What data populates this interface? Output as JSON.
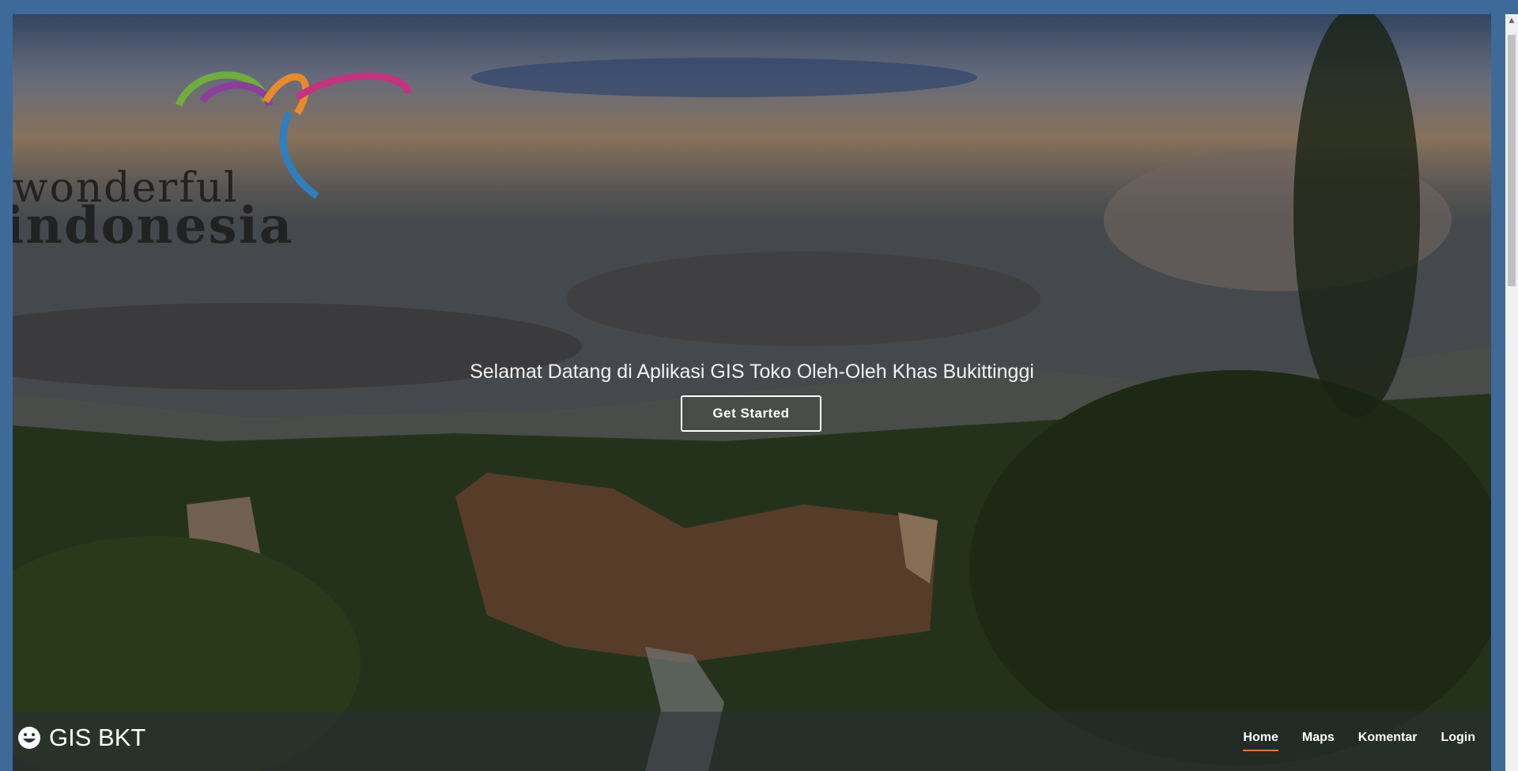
{
  "logo": {
    "line1": "wonderful",
    "line2": "indonesia"
  },
  "hero": {
    "title": "Selamat Datang di Aplikasi GIS Toko Oleh-Oleh Khas Bukittinggi",
    "cta_label": "Get Started"
  },
  "navbar": {
    "brand": "GIS BKT",
    "brand_icon": "grin-icon",
    "links": [
      {
        "label": "Home",
        "active": true
      },
      {
        "label": "Maps",
        "active": false
      },
      {
        "label": "Komentar",
        "active": false
      },
      {
        "label": "Login",
        "active": false
      }
    ],
    "active_underline_color": "#e8743b"
  }
}
